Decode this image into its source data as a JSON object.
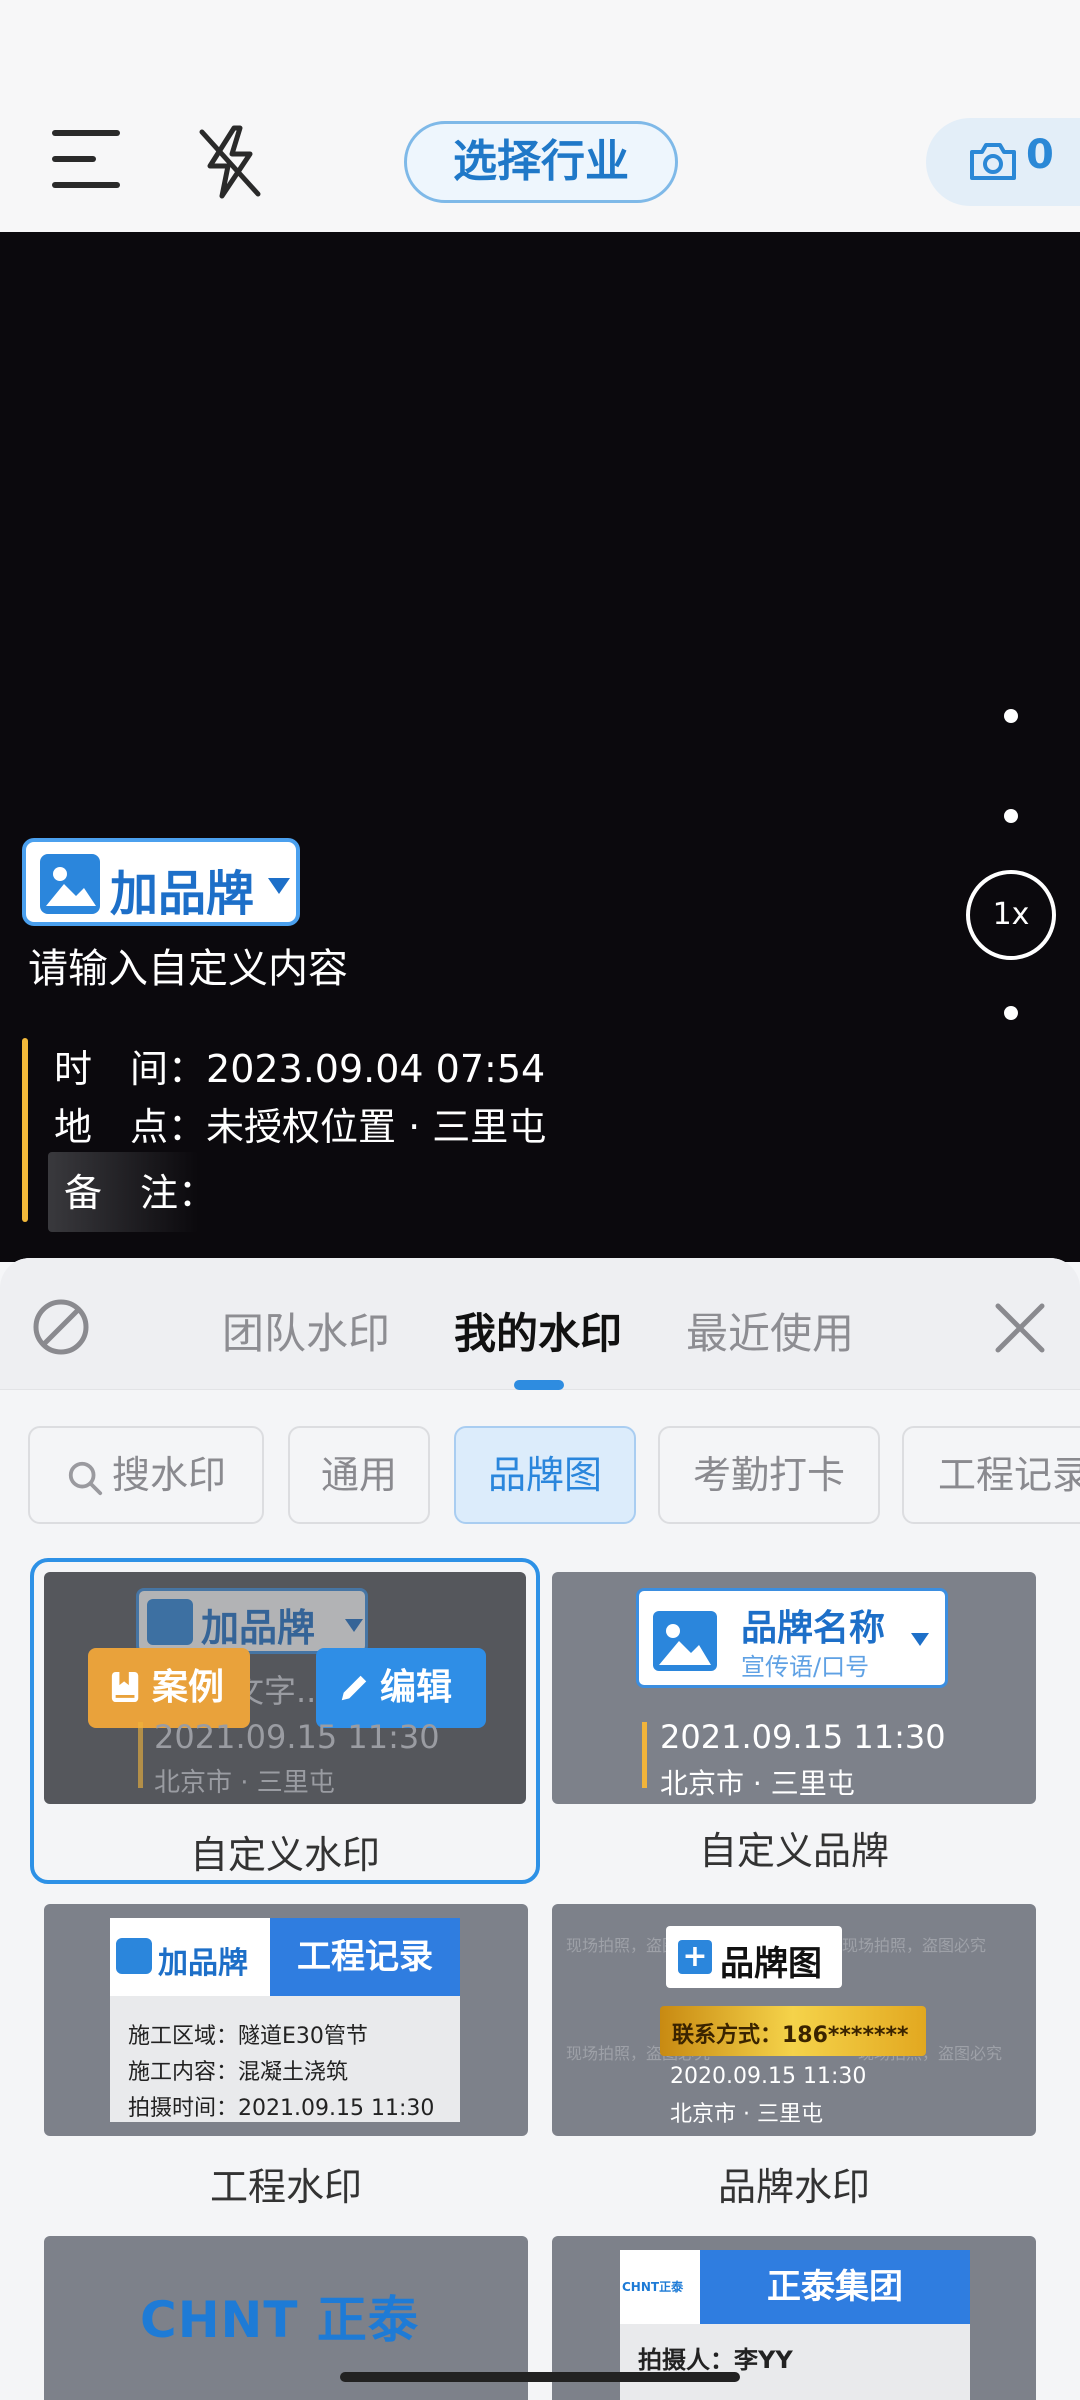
{
  "topbar": {
    "menu_icon": "menu-icon",
    "flash_icon": "flash-off-icon",
    "industry_button": "选择行业",
    "photo_count": "0"
  },
  "viewport": {
    "zoom_label": "1x",
    "brand_tag": "加品牌",
    "custom_text": "请输入自定义内容",
    "time_label": "时　间：",
    "time_value": "2023.09.04 07:54",
    "location_label": "地　点：",
    "location_value": "未授权位置 · 三里屯",
    "note_label": "备　注："
  },
  "sheet": {
    "tabs": [
      {
        "label": "团队水印"
      },
      {
        "label": "我的水印"
      },
      {
        "label": "最近使用"
      }
    ],
    "active_tab": "我的水印",
    "chips": [
      {
        "label": "搜水印"
      },
      {
        "label": "通用"
      },
      {
        "label": "品牌图"
      },
      {
        "label": "考勤打卡"
      },
      {
        "label": "工程记录"
      }
    ],
    "cards": [
      {
        "label": "自定义水印",
        "brand": "加品牌",
        "text_hint": "文字...",
        "case_btn": "案例",
        "edit_btn": "编辑",
        "time": "2021.09.15  11:30",
        "location": "北京市 · 三里屯"
      },
      {
        "label": "自定义品牌",
        "brand_name": "品牌名称",
        "slogan": "宣传语/口号",
        "time": "2021.09.15  11:30",
        "location": "北京市 · 三里屯"
      },
      {
        "label": "工程水印",
        "brand": "加品牌",
        "header": "工程记录",
        "rows": [
          "施工区域：隧道E30管节",
          "施工内容：混凝土浇筑",
          "拍摄时间：2021.09.15 11:30"
        ]
      },
      {
        "label": "品牌水印",
        "brand": "品牌图",
        "contact": "联系方式：186*******",
        "time": "2020.09.15  11:30",
        "location": "北京市 · 三里屯",
        "watermark_text": "现场拍照，盗图必究"
      },
      {
        "logo": "CHNT 正泰"
      },
      {
        "logo_small": "CHNT正泰",
        "header": "正泰集团",
        "row": "拍摄人：李YY"
      }
    ]
  },
  "colors": {
    "accent": "#2d91e6",
    "brand_blue": "#1d6fc8",
    "highlight_yellow": "#f2b43a"
  }
}
